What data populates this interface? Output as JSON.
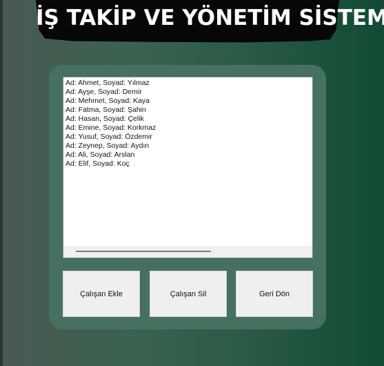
{
  "header": {
    "title": "İŞ TAKİP VE YÖNETİM SİSTEMİ"
  },
  "employees": [
    "Ad: Ahmet, Soyad: Yılmaz",
    "Ad: Ayşe, Soyad: Demir",
    "Ad: Mehmet, Soyad: Kaya",
    "Ad: Fatma, Soyad: Şahin",
    "Ad: Hasan, Soyad: Çelik",
    "Ad: Emine, Soyad: Korkmaz",
    "Ad: Yusuf, Soyad: Özdemir",
    "Ad: Zeynep, Soyad: Aydın",
    "Ad: Ali, Soyad: Arslan",
    "Ad: Elif, Soyad: Koç"
  ],
  "buttons": {
    "add": "Çalışan Ekle",
    "delete": "Çalışan Sil",
    "back": "Geri Dön"
  }
}
